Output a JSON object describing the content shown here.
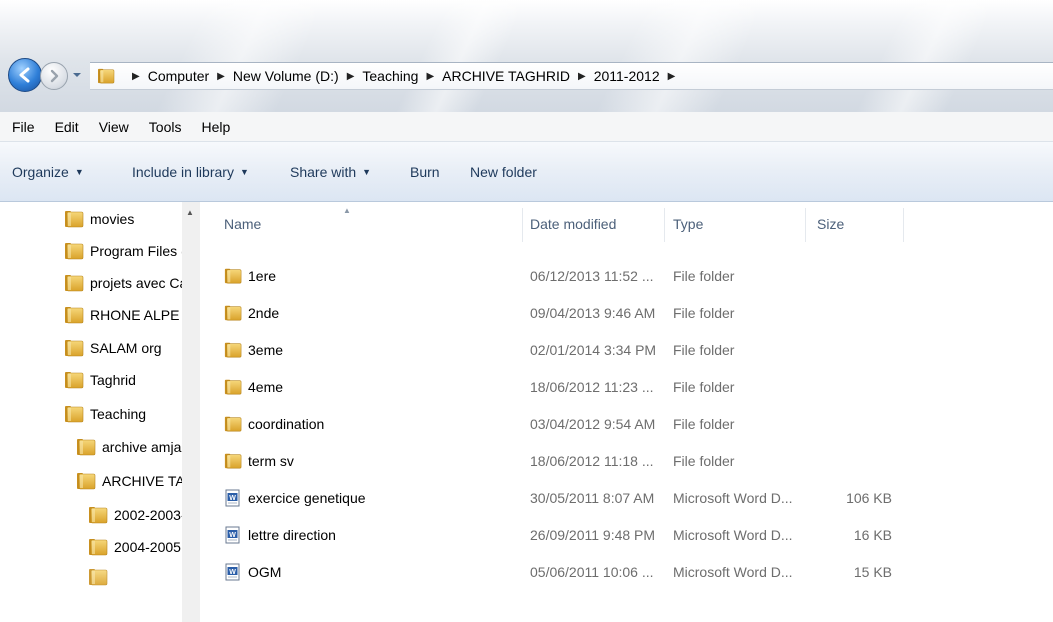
{
  "address": {
    "breadcrumbs": [
      "Computer",
      "New Volume (D:)",
      "Teaching",
      "ARCHIVE TAGHRID",
      "2011-2012"
    ]
  },
  "menu": [
    "File",
    "Edit",
    "View",
    "Tools",
    "Help"
  ],
  "toolbar": {
    "organize": "Organize",
    "include_in_library": "Include in library",
    "share_with": "Share with",
    "burn": "Burn",
    "new_folder": "New folder"
  },
  "nav": {
    "items": [
      {
        "label": "movies"
      },
      {
        "label": "Program Files ("
      },
      {
        "label": "projets avec Ca"
      },
      {
        "label": "RHONE ALPE"
      },
      {
        "label": "SALAM org"
      },
      {
        "label": "Taghrid"
      },
      {
        "label": "Teaching"
      },
      {
        "label": "archive amja"
      },
      {
        "label": "ARCHIVE TA"
      },
      {
        "label": "2002-2003-"
      },
      {
        "label": "2004-2005"
      }
    ]
  },
  "columns": {
    "name": "Name",
    "date_modified": "Date modified",
    "type": "Type",
    "size": "Size"
  },
  "files": [
    {
      "name": "1ere",
      "date": "06/12/2013 11:52 ...",
      "type": "File folder",
      "size": "",
      "icon": "folder-icon"
    },
    {
      "name": "2nde",
      "date": "09/04/2013 9:46 AM",
      "type": "File folder",
      "size": "",
      "icon": "folder-icon"
    },
    {
      "name": "3eme",
      "date": "02/01/2014 3:34 PM",
      "type": "File folder",
      "size": "",
      "icon": "folder-icon"
    },
    {
      "name": "4eme",
      "date": "18/06/2012 11:23 ...",
      "type": "File folder",
      "size": "",
      "icon": "folder-icon"
    },
    {
      "name": "coordination",
      "date": "03/04/2012 9:54 AM",
      "type": "File folder",
      "size": "",
      "icon": "folder-icon"
    },
    {
      "name": "term sv",
      "date": "18/06/2012 11:18 ...",
      "type": "File folder",
      "size": "",
      "icon": "folder-icon"
    },
    {
      "name": "exercice genetique",
      "date": "30/05/2011 8:07 AM",
      "type": "Microsoft Word D...",
      "size": "106 KB",
      "icon": "word-doc-icon"
    },
    {
      "name": "lettre direction",
      "date": "26/09/2011 9:48 PM",
      "type": "Microsoft Word D...",
      "size": "16 KB",
      "icon": "word-doc-icon"
    },
    {
      "name": "OGM",
      "date": "05/06/2011 10:06 ...",
      "type": "Microsoft Word D...",
      "size": "15 KB",
      "icon": "word-doc-icon"
    }
  ],
  "colors": {
    "folder": "#e8b73a",
    "accent": "#1e395b"
  }
}
